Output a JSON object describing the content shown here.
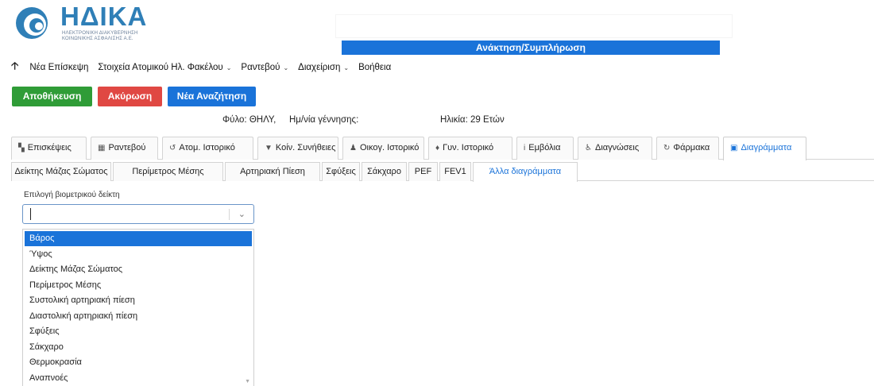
{
  "logo": {
    "title": "ΗΔΙΚΑ",
    "subtitle_line1": "ΗΛΕΚΤΡΟΝΙΚΗ ΔΙΑΚΥΒΕΡΝΗΣΗ",
    "subtitle_line2": "ΚΟΙΝΩΝΙΚΗΣ ΑΣΦΑΛΙΣΗΣ Α.Ε."
  },
  "header": {
    "banner": "Ανάκτηση/Συμπλήρωση"
  },
  "menu": {
    "up_icon": "arrow-up-icon",
    "items": [
      {
        "label": "Νέα Επίσκεψη",
        "has_caret": false
      },
      {
        "label": "Στοιχεία Ατομικού Ηλ. Φακέλου",
        "has_caret": true
      },
      {
        "label": "Ραντεβού",
        "has_caret": true
      },
      {
        "label": "Διαχείριση",
        "has_caret": true
      },
      {
        "label": "Βοήθεια",
        "has_caret": false
      }
    ]
  },
  "actions": {
    "save": "Αποθήκευση",
    "cancel": "Ακύρωση",
    "new_search": "Νέα Αναζήτηση",
    "colors": {
      "save": "#2f9c37",
      "cancel": "#e04843",
      "new_search": "#1a73d9"
    }
  },
  "patient": {
    "gender": "Φύλο: ΘΗΛΥ,",
    "dob_label": "Ημ/νία γέννησης:",
    "age": "Ηλικία: 29 Ετών"
  },
  "main_tabs": [
    {
      "icon": "visits-icon",
      "glyph": "▚",
      "label": "Επισκέψεις",
      "active": false
    },
    {
      "icon": "calendar-icon",
      "glyph": "▦",
      "label": "Ραντεβού",
      "active": false
    },
    {
      "icon": "history-icon",
      "glyph": "↺",
      "label": "Ατομ. Ιστορικό",
      "active": false
    },
    {
      "icon": "filter-icon",
      "glyph": "▼",
      "label": "Κοίν. Συνήθειες",
      "active": false
    },
    {
      "icon": "family-icon",
      "glyph": "♟",
      "label": "Οικογ. Ιστορικό",
      "active": false
    },
    {
      "icon": "gyn-icon",
      "glyph": "♦",
      "label": "Γυν. Ιστορικό",
      "active": false
    },
    {
      "icon": "vaccine-icon",
      "glyph": "i",
      "label": "Εμβόλια",
      "active": false
    },
    {
      "icon": "diagnosis-icon",
      "glyph": "♿",
      "label": "Διαγνώσεις",
      "active": false
    },
    {
      "icon": "medicine-icon",
      "glyph": "↻",
      "label": "Φάρμακα",
      "active": false
    },
    {
      "icon": "chart-icon",
      "glyph": "▣",
      "label": "Διαγράμματα",
      "active": true
    }
  ],
  "sub_tabs": [
    {
      "label": "Δείκτης Μάζας Σώματος",
      "active": false
    },
    {
      "label": "Περίμετρος Μέσης",
      "active": false
    },
    {
      "label": "Αρτηριακή Πίεση",
      "active": false
    },
    {
      "label": "Σφύξεις",
      "active": false
    },
    {
      "label": "Σάκχαρο",
      "active": false
    },
    {
      "label": "PEF",
      "active": false
    },
    {
      "label": "FEV1",
      "active": false
    },
    {
      "label": "Άλλα διαγράμματα",
      "active": true
    }
  ],
  "biometric_select": {
    "label": "Επιλογή βιομετρικού δείκτη",
    "value": "",
    "options": [
      {
        "label": "Βάρος",
        "highlighted": true
      },
      {
        "label": "Ύψος",
        "highlighted": false
      },
      {
        "label": "Δείκτης Μάζας Σώματος",
        "highlighted": false
      },
      {
        "label": "Περίμετρος Μέσης",
        "highlighted": false
      },
      {
        "label": "Συστολική αρτηριακή πίεση",
        "highlighted": false
      },
      {
        "label": "Διαστολική αρτηριακή πίεση",
        "highlighted": false
      },
      {
        "label": "Σφύξεις",
        "highlighted": false
      },
      {
        "label": "Σάκχαρο",
        "highlighted": false
      },
      {
        "label": "Θερμοκρασία",
        "highlighted": false
      },
      {
        "label": "Αναπνοές",
        "highlighted": false
      }
    ]
  }
}
